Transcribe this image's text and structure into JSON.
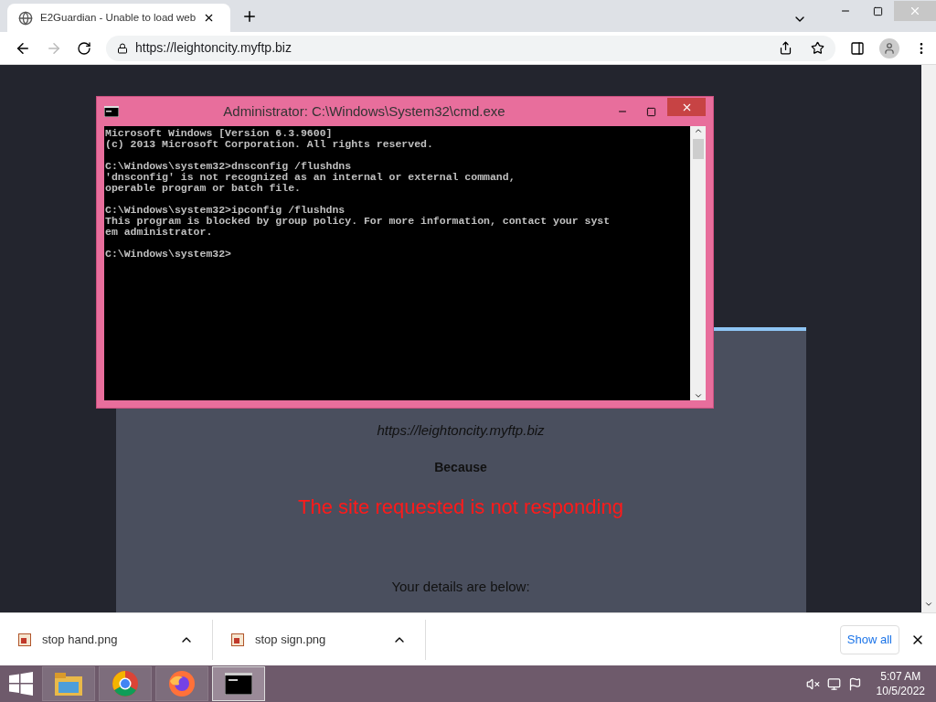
{
  "browser": {
    "tab": {
      "title": "E2Guardian - Unable to load web",
      "selected": true
    },
    "address": "https://leightoncity.myftp.biz"
  },
  "page": {
    "url": "https://leightoncity.myftp.biz",
    "because": "Because",
    "reason": "The site requested is not responding",
    "details": "Your details are below:"
  },
  "cmd": {
    "title": "Administrator: C:\\Windows\\System32\\cmd.exe",
    "blocks": [
      [
        "Microsoft Windows [Version 6.3.9600]",
        "(c) 2013 Microsoft Corporation. All rights reserved."
      ],
      [
        "C:\\Windows\\system32>dnsconfig /flushdns",
        "'dnsconfig' is not recognized as an internal or external command,",
        "operable program or batch file."
      ],
      [
        "C:\\Windows\\system32>ipconfig /flushdns",
        "This program is blocked by group policy. For more information, contact your syst",
        "em administrator."
      ],
      [
        "C:\\Windows\\system32>"
      ]
    ]
  },
  "downloads": {
    "items": [
      {
        "name": "stop hand.png"
      },
      {
        "name": "stop sign.png"
      }
    ],
    "show_all": "Show all"
  },
  "taskbar": {
    "apps": [
      {
        "kind": "explorer",
        "selected": false
      },
      {
        "kind": "chrome",
        "selected": false
      },
      {
        "kind": "firefox",
        "selected": false
      },
      {
        "kind": "cmd",
        "selected": true
      }
    ],
    "time": "5:07 AM",
    "date": "10/5/2022"
  }
}
